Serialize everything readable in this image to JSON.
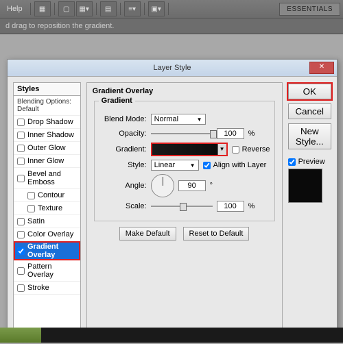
{
  "menu": {
    "help": "Help"
  },
  "workspace": {
    "essentials": "ESSENTIALS"
  },
  "optionbar": {
    "hint": "d drag to reposition the gradient."
  },
  "dialog": {
    "title": "Layer Style",
    "styles_header": "Styles",
    "blending": "Blending Options: Default",
    "effects": [
      "Drop Shadow",
      "Inner Shadow",
      "Outer Glow",
      "Inner Glow",
      "Bevel and Emboss",
      "Contour",
      "Texture",
      "Satin",
      "Color Overlay",
      "Gradient Overlay",
      "Pattern Overlay",
      "Stroke"
    ],
    "section_title": "Gradient Overlay",
    "subsection": "Gradient",
    "labels": {
      "blendmode": "Blend Mode:",
      "opacity": "Opacity:",
      "gradient": "Gradient:",
      "reverse": "Reverse",
      "style": "Style:",
      "align": "Align with Layer",
      "angle": "Angle:",
      "scale": "Scale:",
      "pct": "%",
      "deg": "°"
    },
    "values": {
      "blendmode": "Normal",
      "opacity": "100",
      "style": "Linear",
      "angle": "90",
      "scale": "100"
    },
    "buttons": {
      "makedef": "Make Default",
      "reset": "Reset to Default",
      "ok": "OK",
      "cancel": "Cancel",
      "newstyle": "New Style...",
      "preview": "Preview"
    }
  }
}
